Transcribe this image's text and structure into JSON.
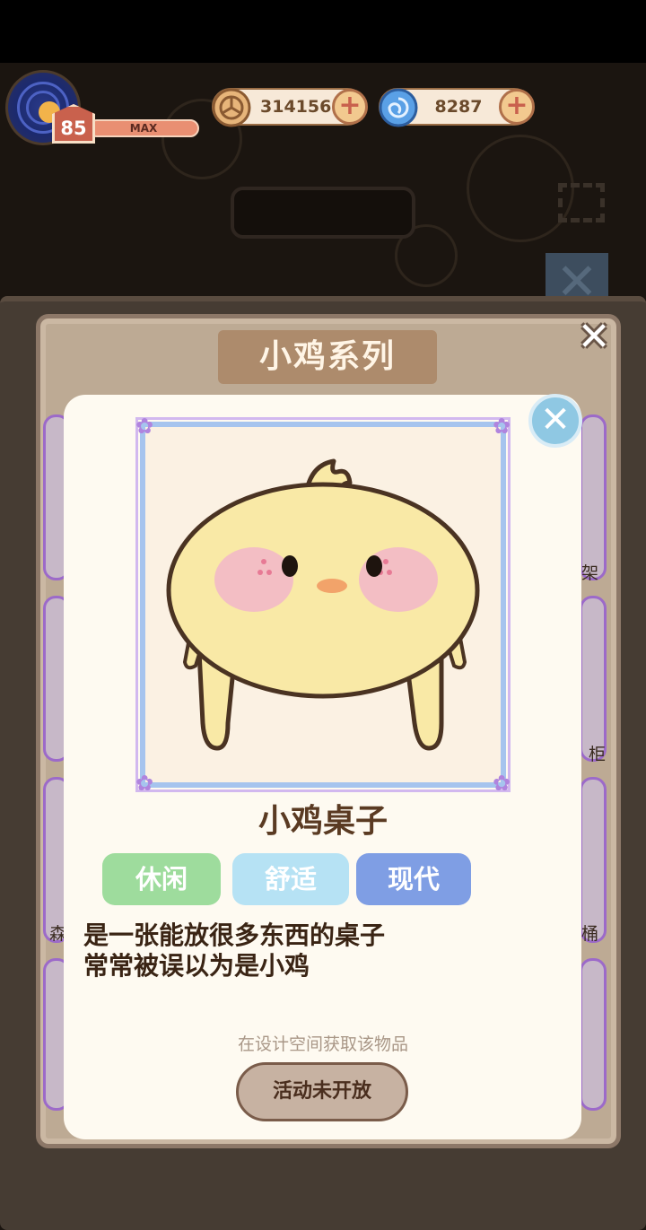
{
  "hud": {
    "level": "85",
    "xp_label": "MAX",
    "coins": "314156",
    "gems": "8287",
    "coin_icon": "coin-icon",
    "gem_icon": "swirl-gem-icon",
    "plus_label": "+"
  },
  "series": {
    "title": "小鸡系列",
    "close_label": "✕"
  },
  "item": {
    "name": "小鸡桌子",
    "tags": [
      {
        "label": "休闲",
        "color": "#9edc9d"
      },
      {
        "label": "舒适",
        "color": "#b6e2f4"
      },
      {
        "label": "现代",
        "color": "#7f9ee4"
      }
    ],
    "description": [
      "是一张能放很多东西的桌子",
      "常常被误以为是小鸡"
    ],
    "obtain_hint": "在设计空间获取该物品",
    "action_button": "活动未开放",
    "close_label": "✕",
    "illustration": "chick-table-illustration"
  },
  "side_partial_labels": {
    "left_mid": "森",
    "right_1": "架",
    "right_2": "柜",
    "right_3": "桶"
  },
  "colors": {
    "panel_bg": "#bdaa94",
    "title_bg": "#ad8b6c",
    "card_bg": "#fefaf1",
    "frame_blue": "#a6c4ee",
    "frame_purple": "#d2b8ef",
    "chick_body": "#f9e9a6",
    "chick_outline": "#4a3322",
    "blush": "#f2b6c9",
    "beak": "#f2a36a"
  }
}
